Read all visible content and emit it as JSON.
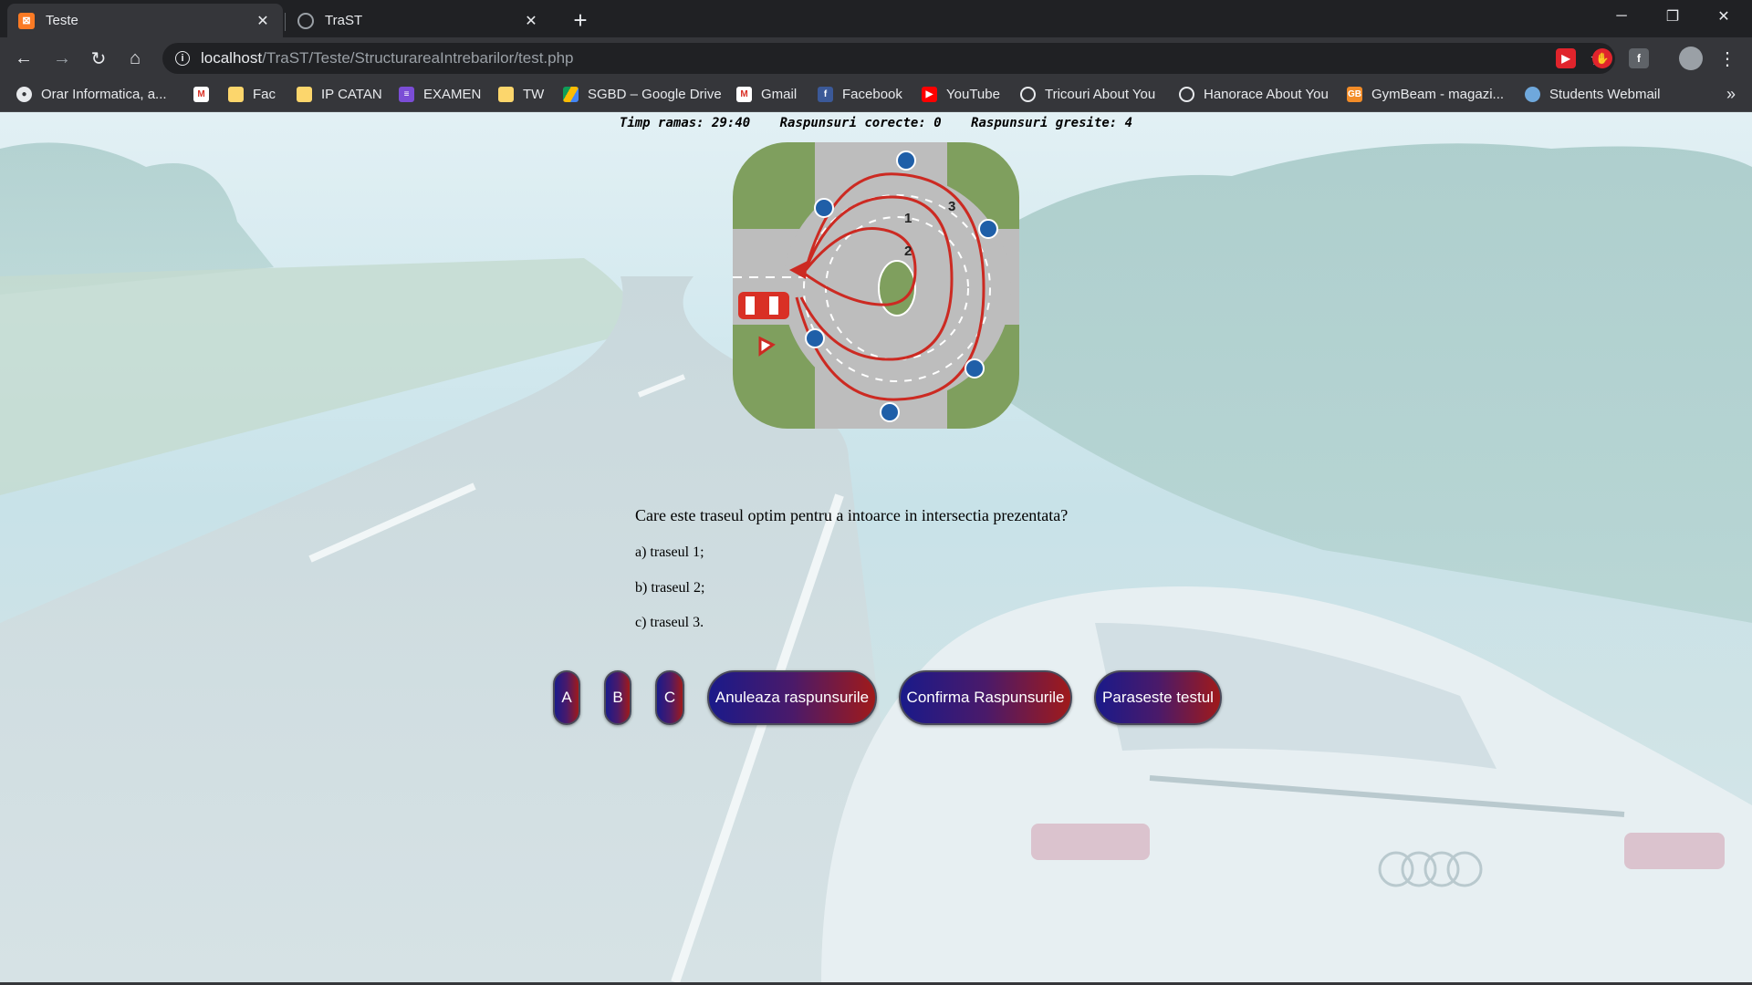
{
  "tabs": [
    {
      "title": "Teste",
      "favicon": "xampp-icon",
      "active": true
    },
    {
      "title": "TraST",
      "favicon": "globe-icon",
      "active": false
    }
  ],
  "address": {
    "host": "localhost",
    "path": "/TraST/Teste/StructurareaIntrebarilor/test.php"
  },
  "bookmarks": [
    {
      "label": "Orar Informatica, a...",
      "icon": "orar-icon"
    },
    {
      "label": "",
      "icon": "gmail-icon"
    },
    {
      "label": "Fac",
      "icon": "folder-icon"
    },
    {
      "label": "IP CATAN",
      "icon": "folder-icon"
    },
    {
      "label": "EXAMEN",
      "icon": "list-icon"
    },
    {
      "label": "TW",
      "icon": "folder-icon"
    },
    {
      "label": "SGBD – Google Drive",
      "icon": "drive-icon"
    },
    {
      "label": "Gmail",
      "icon": "gmail-icon"
    },
    {
      "label": "Facebook",
      "icon": "facebook-icon"
    },
    {
      "label": "YouTube",
      "icon": "youtube-icon"
    },
    {
      "label": "Tricouri About You",
      "icon": "aboutyou-icon"
    },
    {
      "label": "Hanorace About You",
      "icon": "aboutyou-icon"
    },
    {
      "label": "GymBeam - magazi...",
      "icon": "gymbeam-icon"
    },
    {
      "label": "Students Webmail",
      "icon": "webmail-icon"
    }
  ],
  "status": {
    "time": "Timp ramas: 29:40",
    "correct": "Raspunsuri corecte: 0",
    "wrong": "Raspunsuri gresite: 4"
  },
  "diagram": {
    "labels": [
      "1",
      "2",
      "3"
    ],
    "icon": "roundabout-diagram"
  },
  "question": "Care este traseul optim pentru a intoarce in intersectia prezentata?",
  "answers": [
    "a) traseul 1;",
    "b) traseul 2;",
    "c) traseul 3."
  ],
  "buttons": {
    "a": "A",
    "b": "B",
    "c": "C",
    "cancel": "Anuleaza raspunsurile",
    "confirm": "Confirma Raspunsurile",
    "leave": "Paraseste testul"
  },
  "colors": {
    "accent_start": "#1a1a8a",
    "accent_end": "#a01a1a",
    "chrome": "#35363a"
  }
}
